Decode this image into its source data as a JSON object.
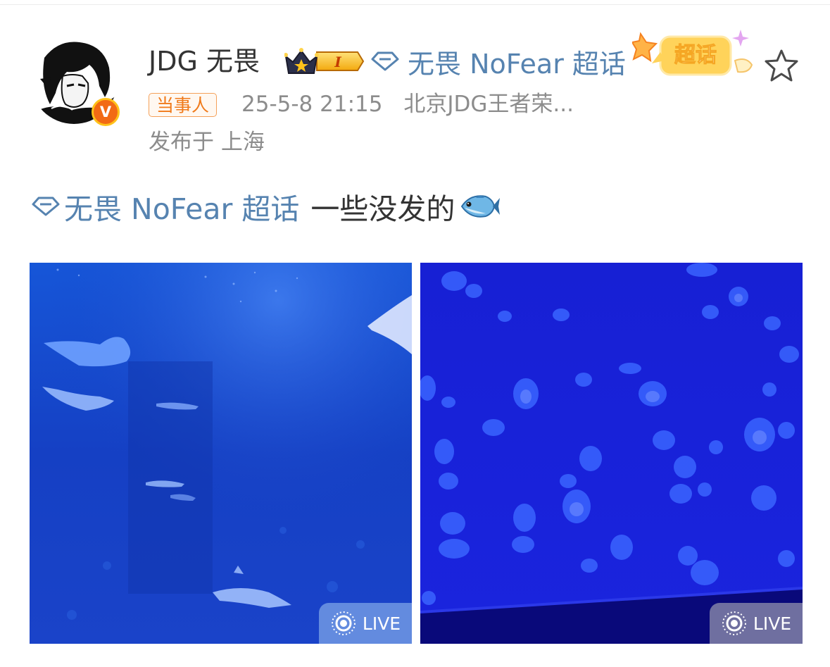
{
  "post": {
    "user": {
      "name": "JDG 无畏",
      "verified_badge": "V",
      "level_badge": "I"
    },
    "header_topic": "无畏 NoFear 超话",
    "super_topic_badge": "超话",
    "tag": "当事人",
    "time": "25-5-8 21:15",
    "source": "北京JDG王者荣...",
    "location": "发布于 上海",
    "text_topic": "无畏 NoFear 超话",
    "text": "一些没发的",
    "emoji_icon": "fish-emoji-icon",
    "media": [
      {
        "type": "live-photo",
        "badge": "LIVE",
        "scene": "stingrays-aquarium"
      },
      {
        "type": "live-photo",
        "badge": "LIVE",
        "scene": "jellyfish-aquarium"
      }
    ]
  },
  "colors": {
    "topic_blue": "#5683b0",
    "tag_orange": "#f07a1a",
    "meta_gray": "#8c8c8c",
    "text_dark": "#333333"
  }
}
